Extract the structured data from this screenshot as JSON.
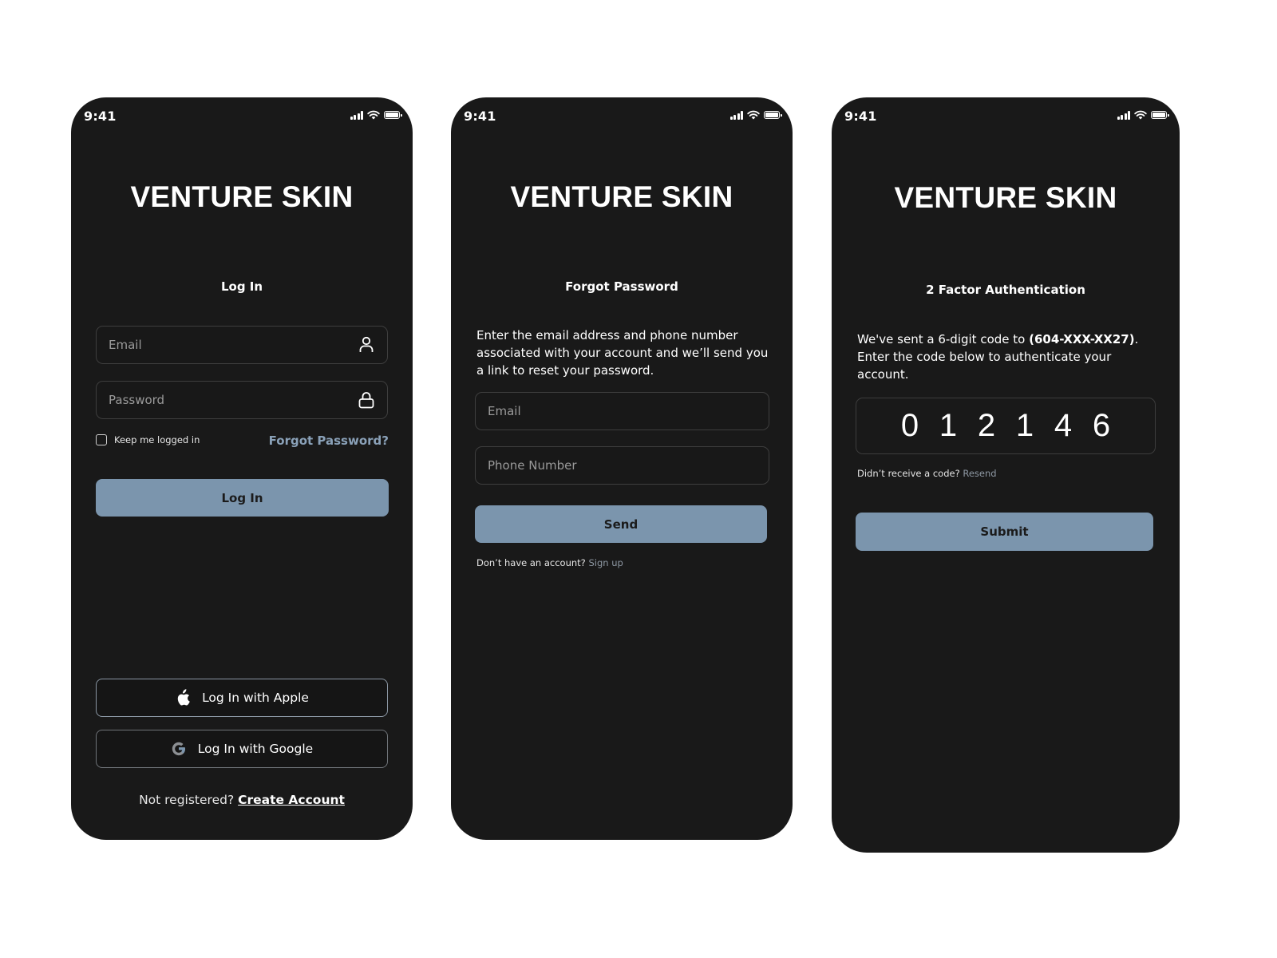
{
  "status_bar": {
    "time": "9:41"
  },
  "brand": {
    "title": "VENTURE SKIN"
  },
  "login": {
    "title": "Log In",
    "email_placeholder": "Email",
    "password_placeholder": "Password",
    "keep_logged_in": "Keep me logged in",
    "forgot_password": "Forgot Password?",
    "login_button": "Log In",
    "apple_button": "Log In with Apple",
    "google_button": "Log In with Google",
    "not_registered": "Not registered?",
    "create_account": "Create Account"
  },
  "forgot": {
    "title": "Forgot Password",
    "description": "Enter the email address and phone number associated with your account and we’ll send you a link to reset your password.",
    "email_placeholder": "Email",
    "phone_placeholder": "Phone Number",
    "send_button": "Send",
    "no_account": "Don’t have an account?",
    "sign_up": "Sign up"
  },
  "twofa": {
    "title": "2 Factor Authentication",
    "description_prefix": "We've sent a 6-digit code to ",
    "phone_masked": "(604-XXX-XX27)",
    "description_suffix": ". Enter the code below to authenticate your account.",
    "code_digits": [
      "0",
      "1",
      "2",
      "1",
      "4",
      "6"
    ],
    "didnt_receive": "Didn’t receive a code?",
    "resend": "Resend",
    "submit_button": "Submit"
  },
  "colors": {
    "background": "#ffffff",
    "phone_bg": "#191919",
    "accent_button": "#7b95ad",
    "link_accent": "#8aa1b8"
  }
}
